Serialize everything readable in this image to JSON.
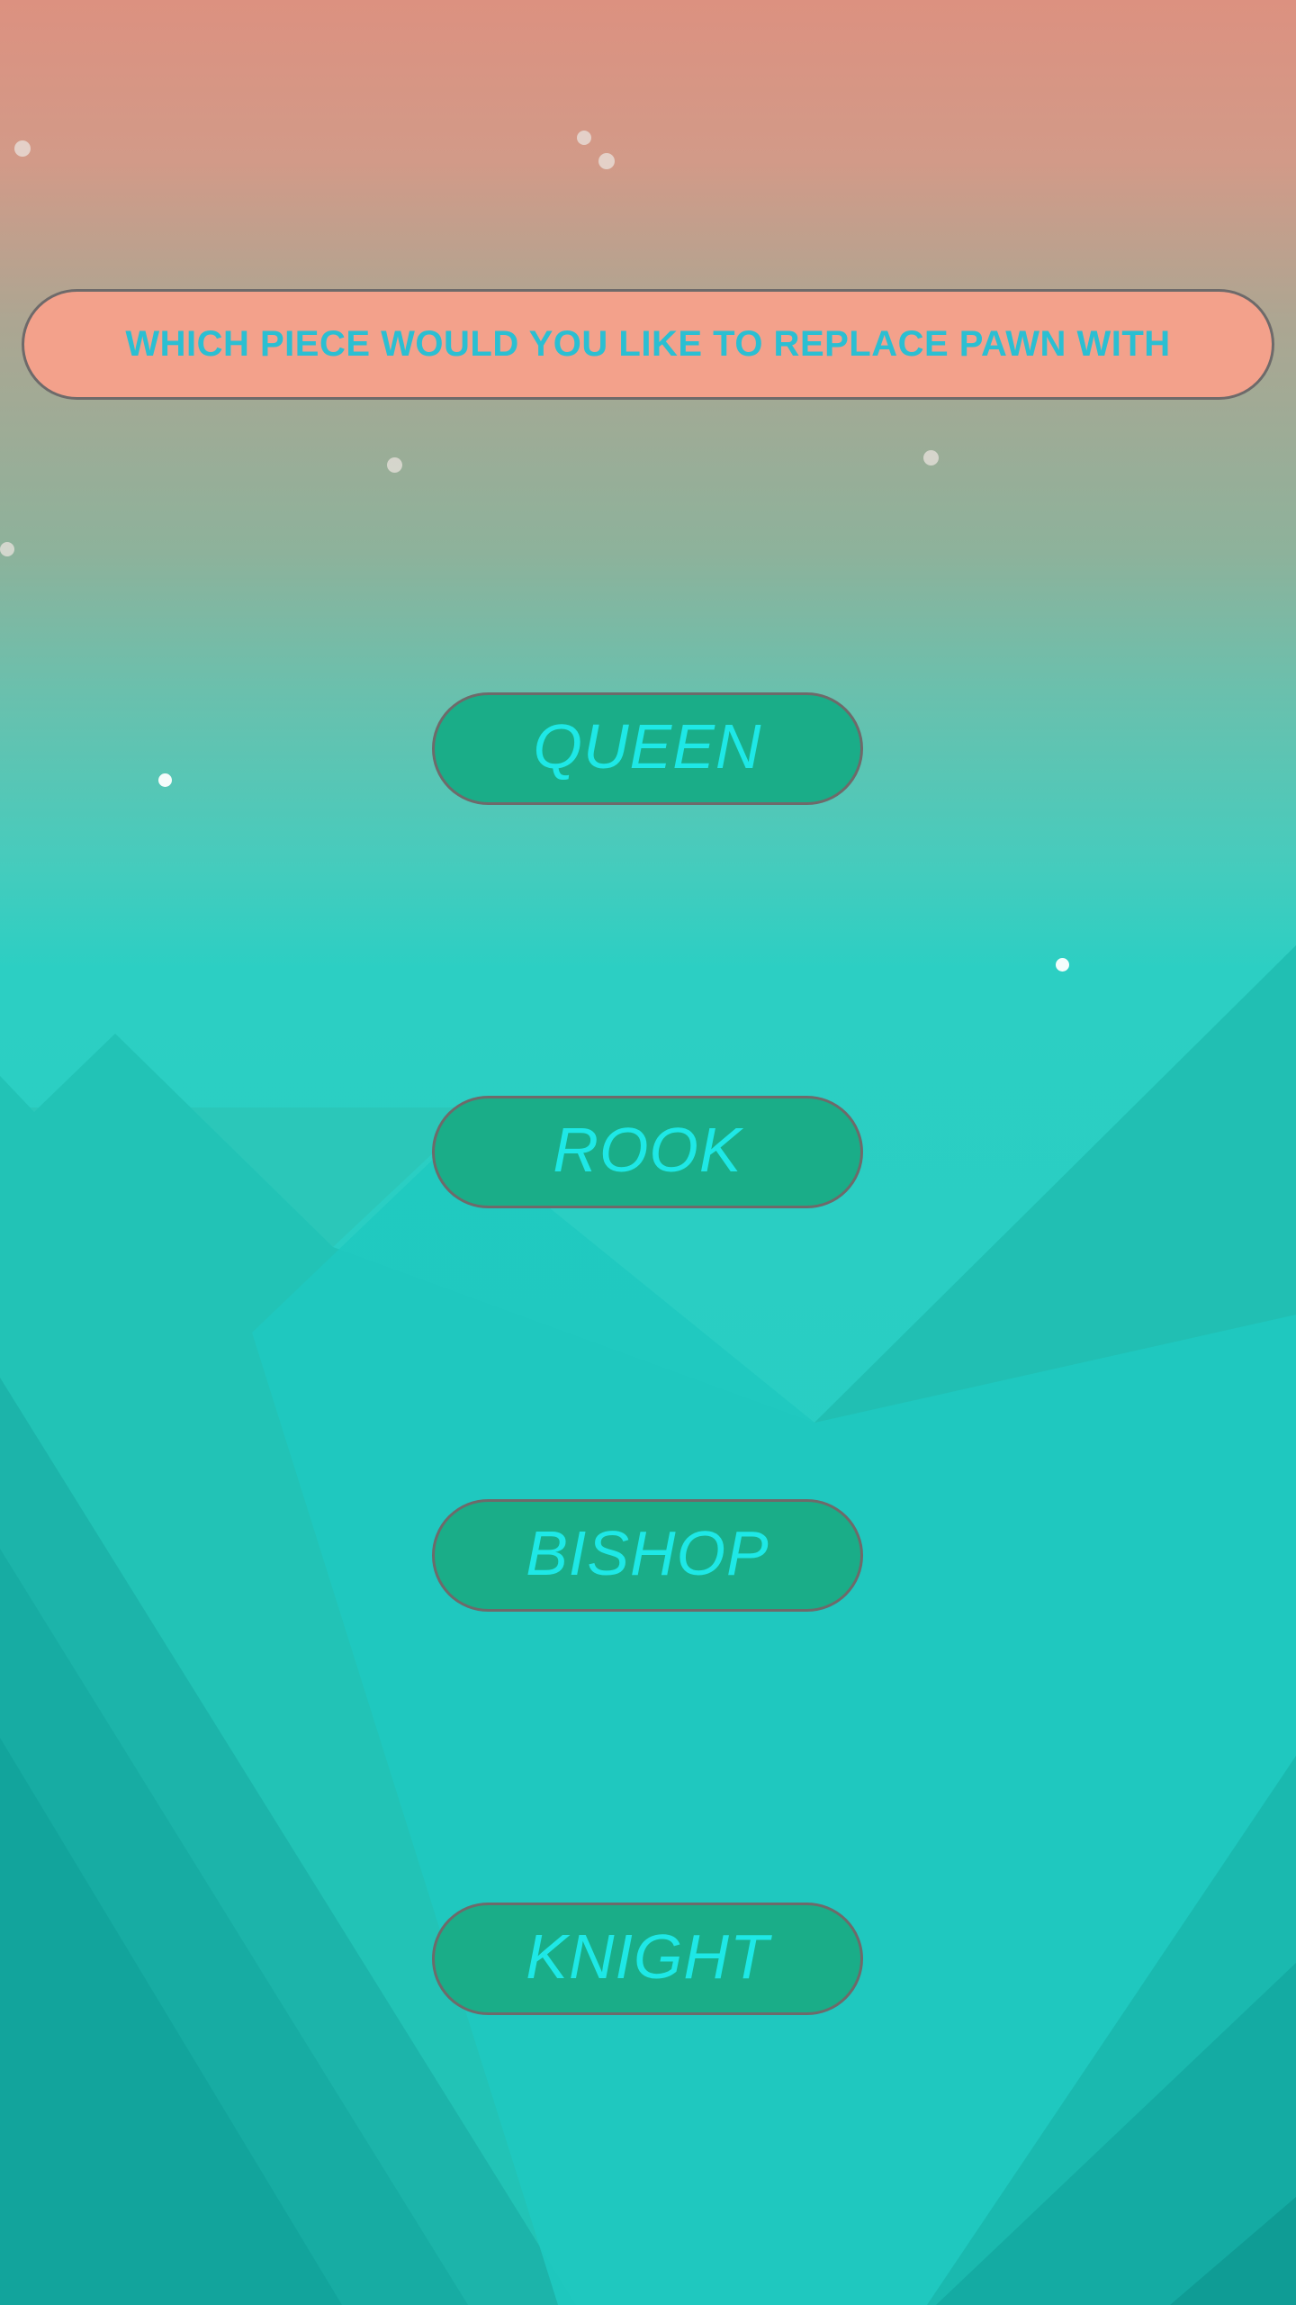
{
  "prompt": {
    "text": "WHICH PIECE WOULD YOU LIKE TO REPLACE PAWN WITH"
  },
  "options": [
    {
      "label": "QUEEN"
    },
    {
      "label": "ROOK"
    },
    {
      "label": "BISHOP"
    },
    {
      "label": "KNIGHT"
    }
  ],
  "colors": {
    "sky_top": "#dc9180",
    "mountain": "#22ccc4",
    "banner_fill": "#f3a18b",
    "banner_text": "#2bbfd2",
    "button_fill": "#1aad88",
    "button_text": "#1ee8e6",
    "border": "#6e6a6a"
  }
}
